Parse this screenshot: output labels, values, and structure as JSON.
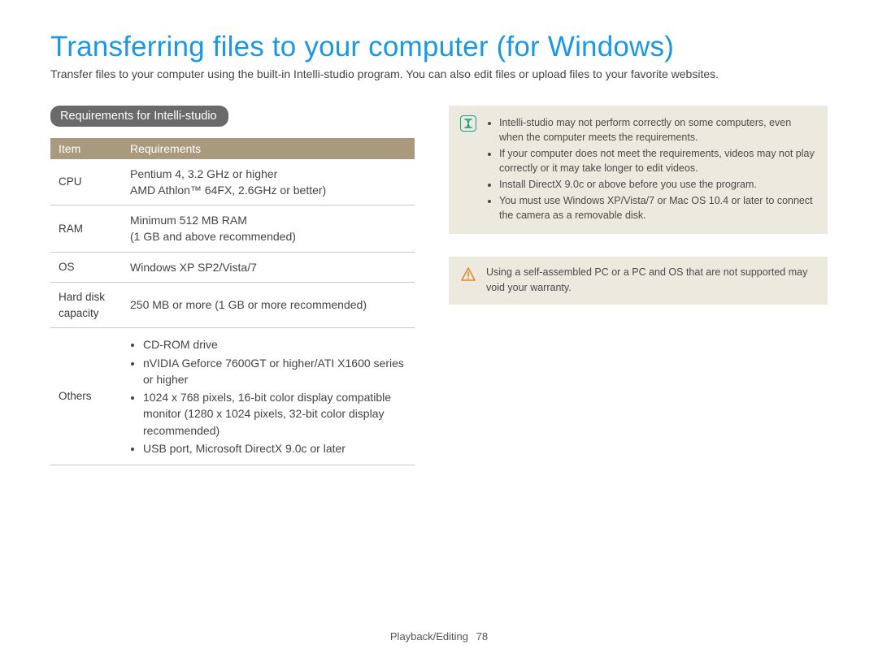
{
  "title": "Transferring files to your computer (for Windows)",
  "intro": "Transfer files to your computer using the built-in Intelli-studio program. You can also edit files or upload files to your favorite websites.",
  "section_heading": "Requirements for Intelli-studio",
  "table": {
    "head": {
      "col1": "Item",
      "col2": "Requirements"
    },
    "rows": {
      "cpu": {
        "label": "CPU",
        "value_l1": "Pentium 4, 3.2 GHz or higher",
        "value_l2": "AMD Athlon™ 64FX, 2.6GHz or better)"
      },
      "ram": {
        "label": "RAM",
        "value_l1": "Minimum 512 MB RAM",
        "value_l2": "(1 GB and above recommended)"
      },
      "os": {
        "label": "OS",
        "value": "Windows XP SP2/Vista/7"
      },
      "hdd": {
        "label": "Hard disk capacity",
        "value": "250 MB or more (1 GB or more recommended)"
      },
      "others": {
        "label": "Others",
        "b1": "CD-ROM drive",
        "b2": "nVIDIA Geforce 7600GT or higher/ATI X1600 series or higher",
        "b3": "1024 x 768 pixels, 16-bit color display compatible monitor (1280 x 1024 pixels, 32-bit color display recommended)",
        "b4": "USB port, Microsoft DirectX 9.0c or later"
      }
    }
  },
  "note_info": {
    "b1": "Intelli-studio may not perform correctly on some computers, even when the computer meets the requirements.",
    "b2": "If your computer does not meet the requirements, videos may not play correctly or it may take longer to edit videos.",
    "b3": "Install DirectX 9.0c or above before you use the program.",
    "b4": "You must use Windows XP/Vista/7 or Mac OS 10.4 or later to connect the camera as a removable disk."
  },
  "note_warn": "Using a self-assembled PC or a PC and OS that are not supported may void your warranty.",
  "footer": {
    "section": "Playback/Editing",
    "page": "78"
  },
  "colors": {
    "accent": "#1a98e6",
    "table_head": "#a99a7e",
    "pill": "#6a6a6a",
    "note_bg": "#ece9de",
    "info": "#16a085",
    "warn": "#e08a2d"
  }
}
